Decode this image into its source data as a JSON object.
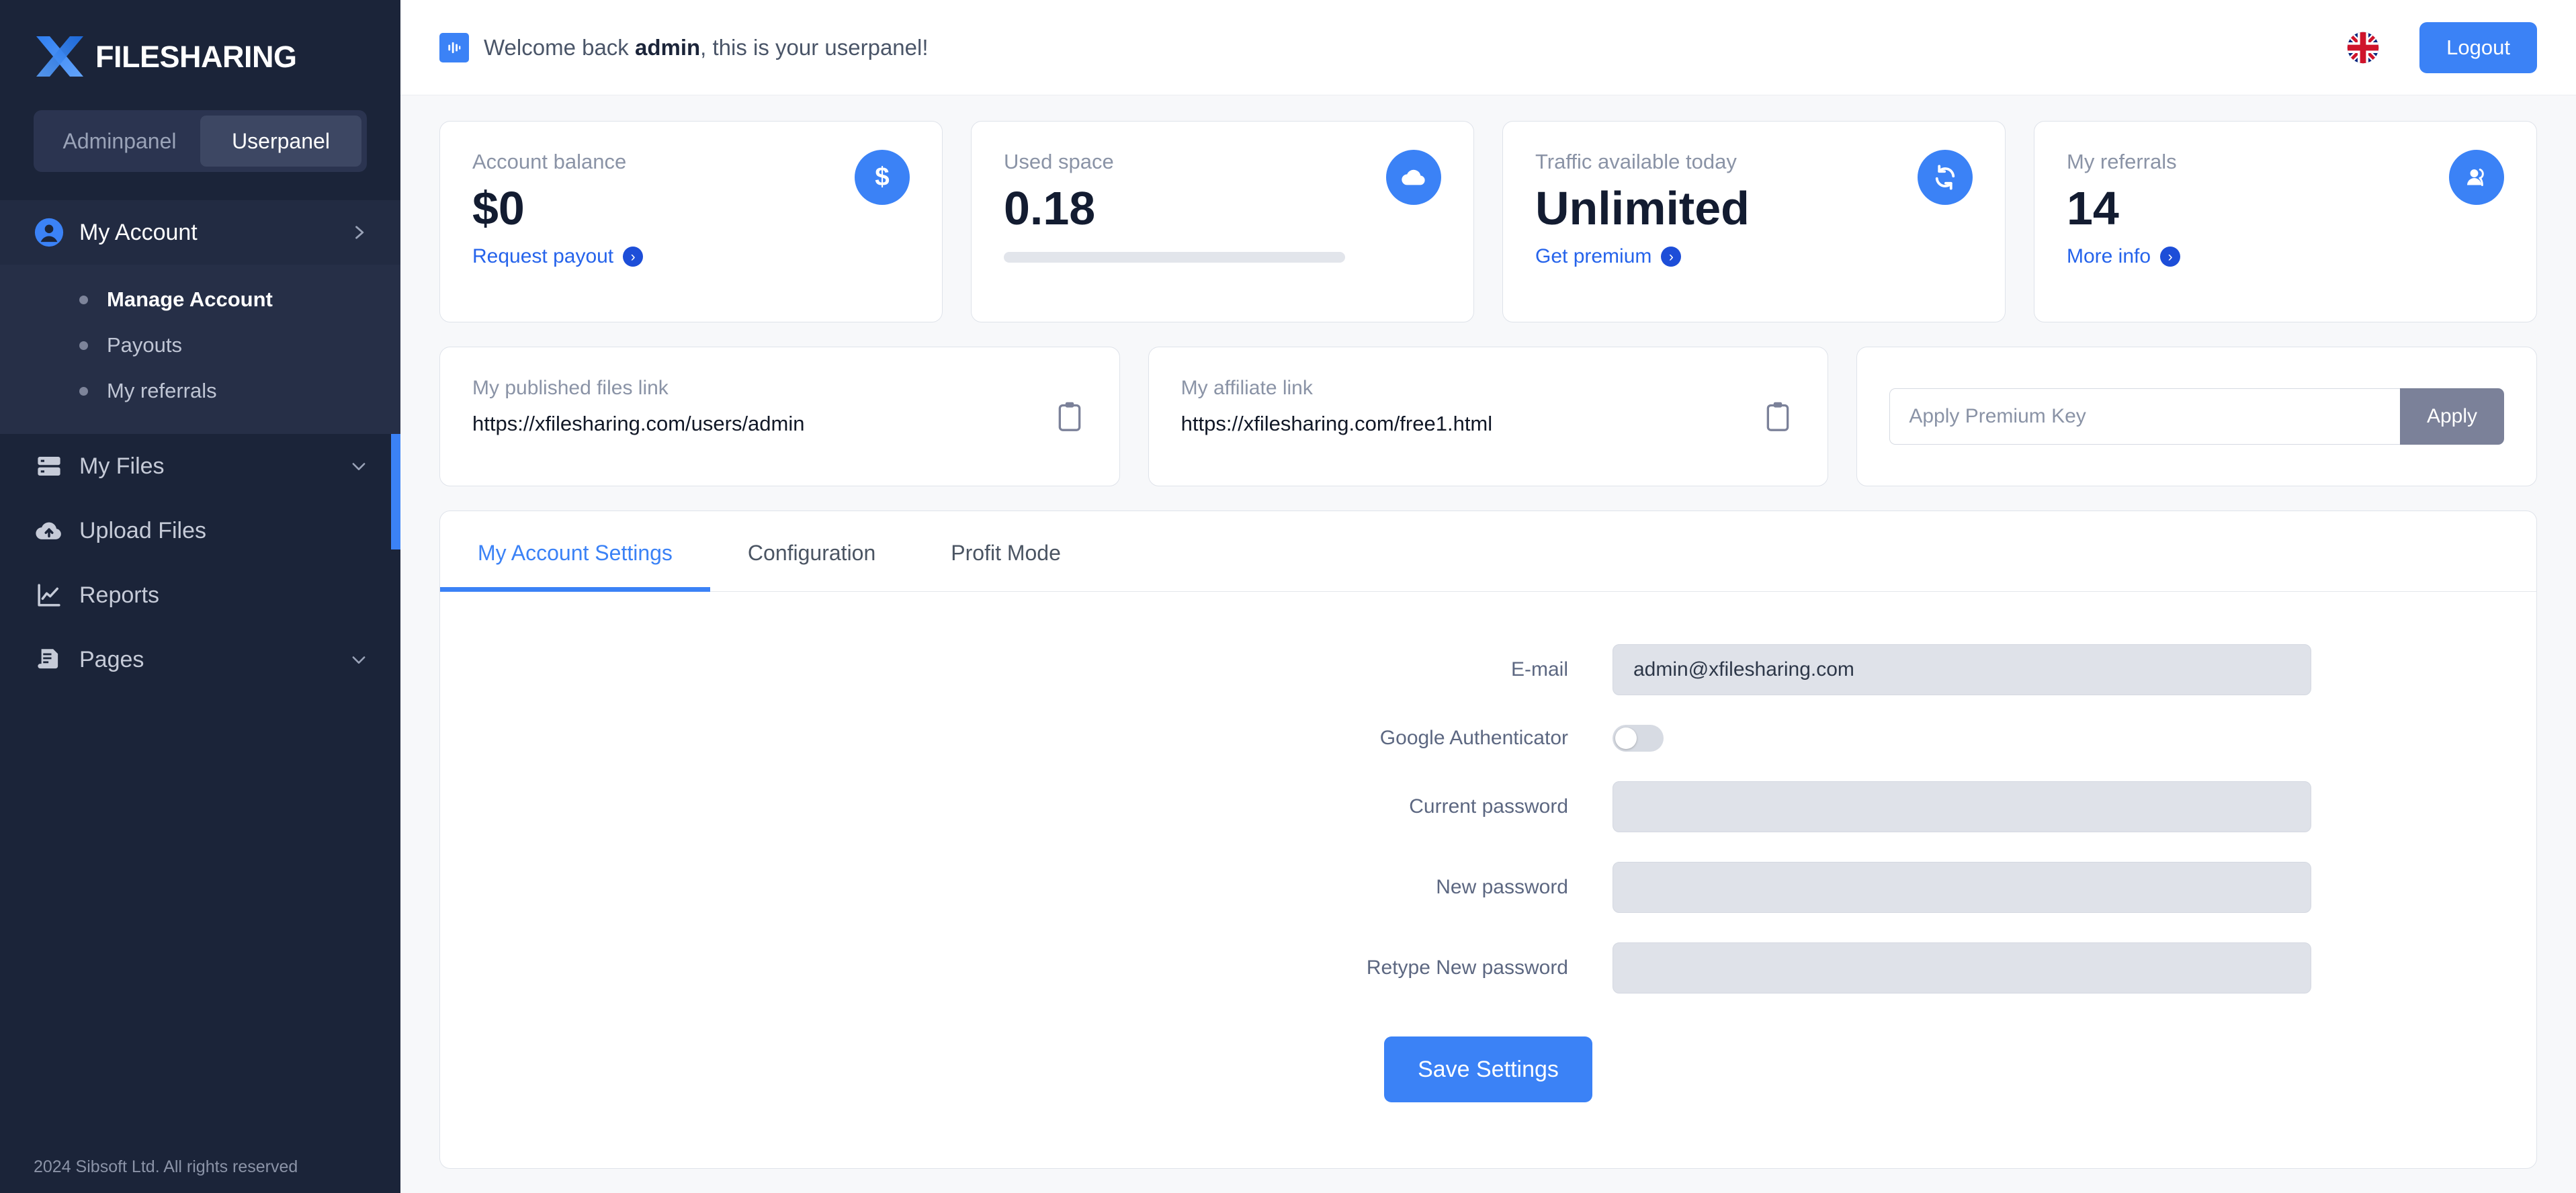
{
  "brand": {
    "name": "FILESHARING",
    "logo_icon": "x-logo-icon"
  },
  "panel_switch": {
    "admin_label": "Adminpanel",
    "user_label": "Userpanel",
    "active": "Userpanel"
  },
  "sidebar": {
    "items": [
      {
        "label": "My Account",
        "icon": "user-circle-icon",
        "expandable": true,
        "active": true
      },
      {
        "label": "My Files",
        "icon": "server-icon",
        "expandable": true,
        "active": false
      },
      {
        "label": "Upload Files",
        "icon": "cloud-upload-icon",
        "expandable": false,
        "active": false
      },
      {
        "label": "Reports",
        "icon": "chart-line-icon",
        "expandable": false,
        "active": false
      },
      {
        "label": "Pages",
        "icon": "document-icon",
        "expandable": true,
        "active": false
      }
    ],
    "submenu": [
      {
        "label": "Manage Account",
        "active": true
      },
      {
        "label": "Payouts",
        "active": false
      },
      {
        "label": "My referrals",
        "active": false
      }
    ],
    "footer": "2024 Sibsoft Ltd. All rights reserved"
  },
  "topbar": {
    "welcome_prefix": "Welcome back ",
    "welcome_user": "admin",
    "welcome_suffix": ", this is your userpanel!",
    "welcome_icon": "chart-bars-icon",
    "flag_icon": "uk-flag-icon",
    "logout_label": "Logout"
  },
  "stats": [
    {
      "title": "Account balance",
      "value": "$0",
      "link": "Request payout",
      "icon": "dollar-icon",
      "has_progress": false
    },
    {
      "title": "Used space",
      "value": "0.18",
      "link": "",
      "icon": "cloud-icon",
      "has_progress": true,
      "progress_percent": 0
    },
    {
      "title": "Traffic available today",
      "value": "Unlimited",
      "link": "Get premium",
      "icon": "refresh-icon",
      "has_progress": false
    },
    {
      "title": "My referrals",
      "value": "14",
      "link": "More info",
      "icon": "users-icon",
      "has_progress": false
    }
  ],
  "links": [
    {
      "title": "My published files link",
      "value": "https://xfilesharing.com/users/admin",
      "copy_icon": "clipboard-icon"
    },
    {
      "title": "My affiliate link",
      "value": "https://xfilesharing.com/free1.html",
      "copy_icon": "clipboard-icon"
    }
  ],
  "premium": {
    "placeholder": "Apply Premium Key",
    "value": "",
    "apply_label": "Apply"
  },
  "panel": {
    "tabs": [
      {
        "label": "My Account Settings",
        "active": true
      },
      {
        "label": "Configuration",
        "active": false
      },
      {
        "label": "Profit Mode",
        "active": false
      }
    ],
    "form": {
      "email_label": "E-mail",
      "email_value": "admin@xfilesharing.com",
      "authenticator_label": "Google Authenticator",
      "authenticator_on": false,
      "current_password_label": "Current password",
      "current_password_value": "",
      "new_password_label": "New password",
      "new_password_value": "",
      "retype_password_label": "Retype New password",
      "retype_password_value": "",
      "save_label": "Save Settings"
    }
  },
  "colors": {
    "accent": "#3b82f6",
    "sidebar_bg": "#1b2439",
    "submenu_bg": "#262f47",
    "page_bg": "#f7f8fa",
    "link_blue": "#2563eb",
    "apply_gray": "#7b8199"
  }
}
